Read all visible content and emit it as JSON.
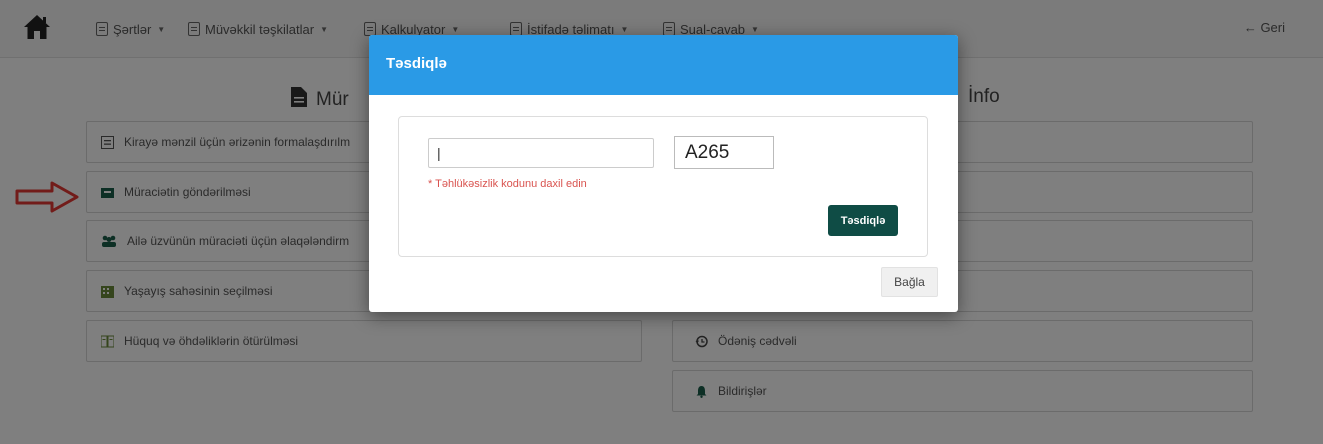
{
  "nav": {
    "items": [
      {
        "label": "Şərtlər"
      },
      {
        "label": "Müvəkkil təşkilatlar"
      },
      {
        "label": "Kalkulyator"
      },
      {
        "label": "İstifadə təlimatı"
      },
      {
        "label": "Sual-cavab"
      }
    ],
    "back_label": "← Geri"
  },
  "main": {
    "left_title": "Mür",
    "right_title": "İnfo",
    "left_items": [
      {
        "label": "Kirayə mənzil üçün ərizənin formalaşdırılm",
        "icon": "form-icon"
      },
      {
        "label": "Müraciətin göndərilməsi",
        "icon": "inbox-icon"
      },
      {
        "label": "Ailə üzvünün müraciəti üçün əlaqələndirm",
        "icon": "users-icon"
      },
      {
        "label": "Yaşayış sahəsinin seçilməsi",
        "icon": "building-icon"
      },
      {
        "label": "Hüquq və öhdəliklərin ötürülməsi",
        "icon": "book-icon"
      }
    ],
    "right_items": [
      {
        "label": "Ödəniş cədvəli",
        "icon": "history-icon"
      },
      {
        "label": "Bildirişlər",
        "icon": "bell-icon"
      }
    ]
  },
  "modal": {
    "title": "Təsdiqlə",
    "input_value": "|",
    "captcha_text": "A265",
    "hint": "* Təhlükəsizlik kodunu daxil edin",
    "confirm_label": "Təsdiqlə",
    "close_label": "Bağla"
  },
  "colors": {
    "header_blue": "#2a9ae6",
    "confirm_green": "#0f4c45",
    "hint_red": "#d9534f",
    "arrow_red": "#e53935"
  }
}
